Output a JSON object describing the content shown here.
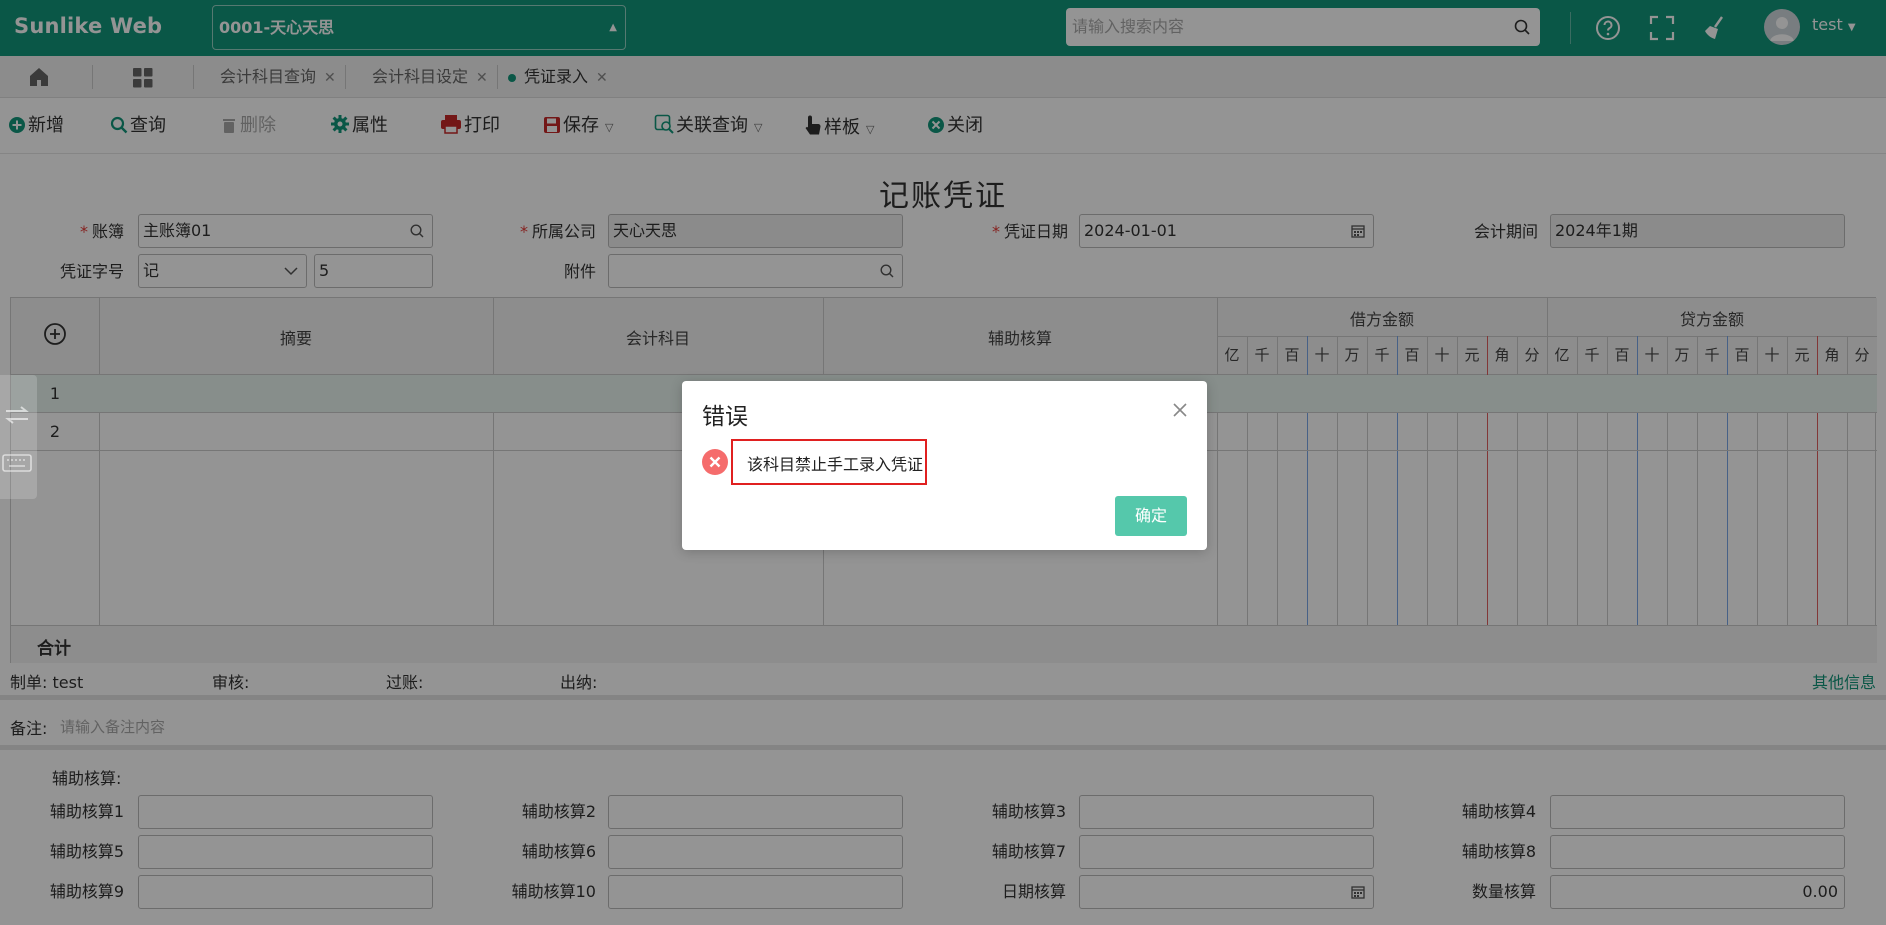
{
  "header": {
    "brand": "Sunlike Web",
    "company": "0001-天心天思",
    "search_placeholder": "请输入搜索内容",
    "user": "test"
  },
  "tabs": [
    {
      "label": "会计科目查询"
    },
    {
      "label": "会计科目设定"
    },
    {
      "label": "凭证录入"
    }
  ],
  "toolbar": {
    "new": "新增",
    "query": "查询",
    "delete": "删除",
    "properties": "属性",
    "print": "打印",
    "save": "保存",
    "related_query": "关联查询",
    "template": "样板",
    "close": "关闭"
  },
  "form": {
    "title": "记账凭证",
    "ledger_label": "账簿",
    "ledger_value": "主账簿01",
    "company_label": "所属公司",
    "company_value": "天心天思",
    "date_label": "凭证日期",
    "date_value": "2024-01-01",
    "period_label": "会计期间",
    "period_value": "2024年1期",
    "voucher_word_label": "凭证字号",
    "voucher_word_value": "记",
    "voucher_no_value": "5",
    "attachment_label": "附件"
  },
  "grid": {
    "col_summary": "摘要",
    "col_account": "会计科目",
    "col_aux": "辅助核算",
    "col_debit": "借方金额",
    "col_credit": "贷方金额",
    "digits": [
      "亿",
      "千",
      "百",
      "十",
      "万",
      "千",
      "百",
      "十",
      "元",
      "角",
      "分"
    ],
    "rows": [
      "1",
      "2"
    ],
    "total_label": "合计"
  },
  "meta": {
    "maker_label": "制单:",
    "maker_value": "test",
    "audit_label": "审核:",
    "post_label": "过账:",
    "cashier_label": "出纳:",
    "other_info": "其他信息"
  },
  "remark": {
    "label": "备注:",
    "placeholder": "请输入备注内容"
  },
  "aux": {
    "title": "辅助核算:",
    "labels": [
      "辅助核算1",
      "辅助核算2",
      "辅助核算3",
      "辅助核算4",
      "辅助核算5",
      "辅助核算6",
      "辅助核算7",
      "辅助核算8",
      "辅助核算9",
      "辅助核算10",
      "日期核算",
      "数量核算"
    ],
    "qty_value": "0.00"
  },
  "dialog": {
    "title": "错误",
    "message": "该科目禁止手工录入凭证",
    "ok": "确定"
  },
  "colors": {
    "brand_green": "#12977a",
    "ok_button": "#55c8ab",
    "error_red": "#f56c6c",
    "highlight_red": "#e02020"
  }
}
